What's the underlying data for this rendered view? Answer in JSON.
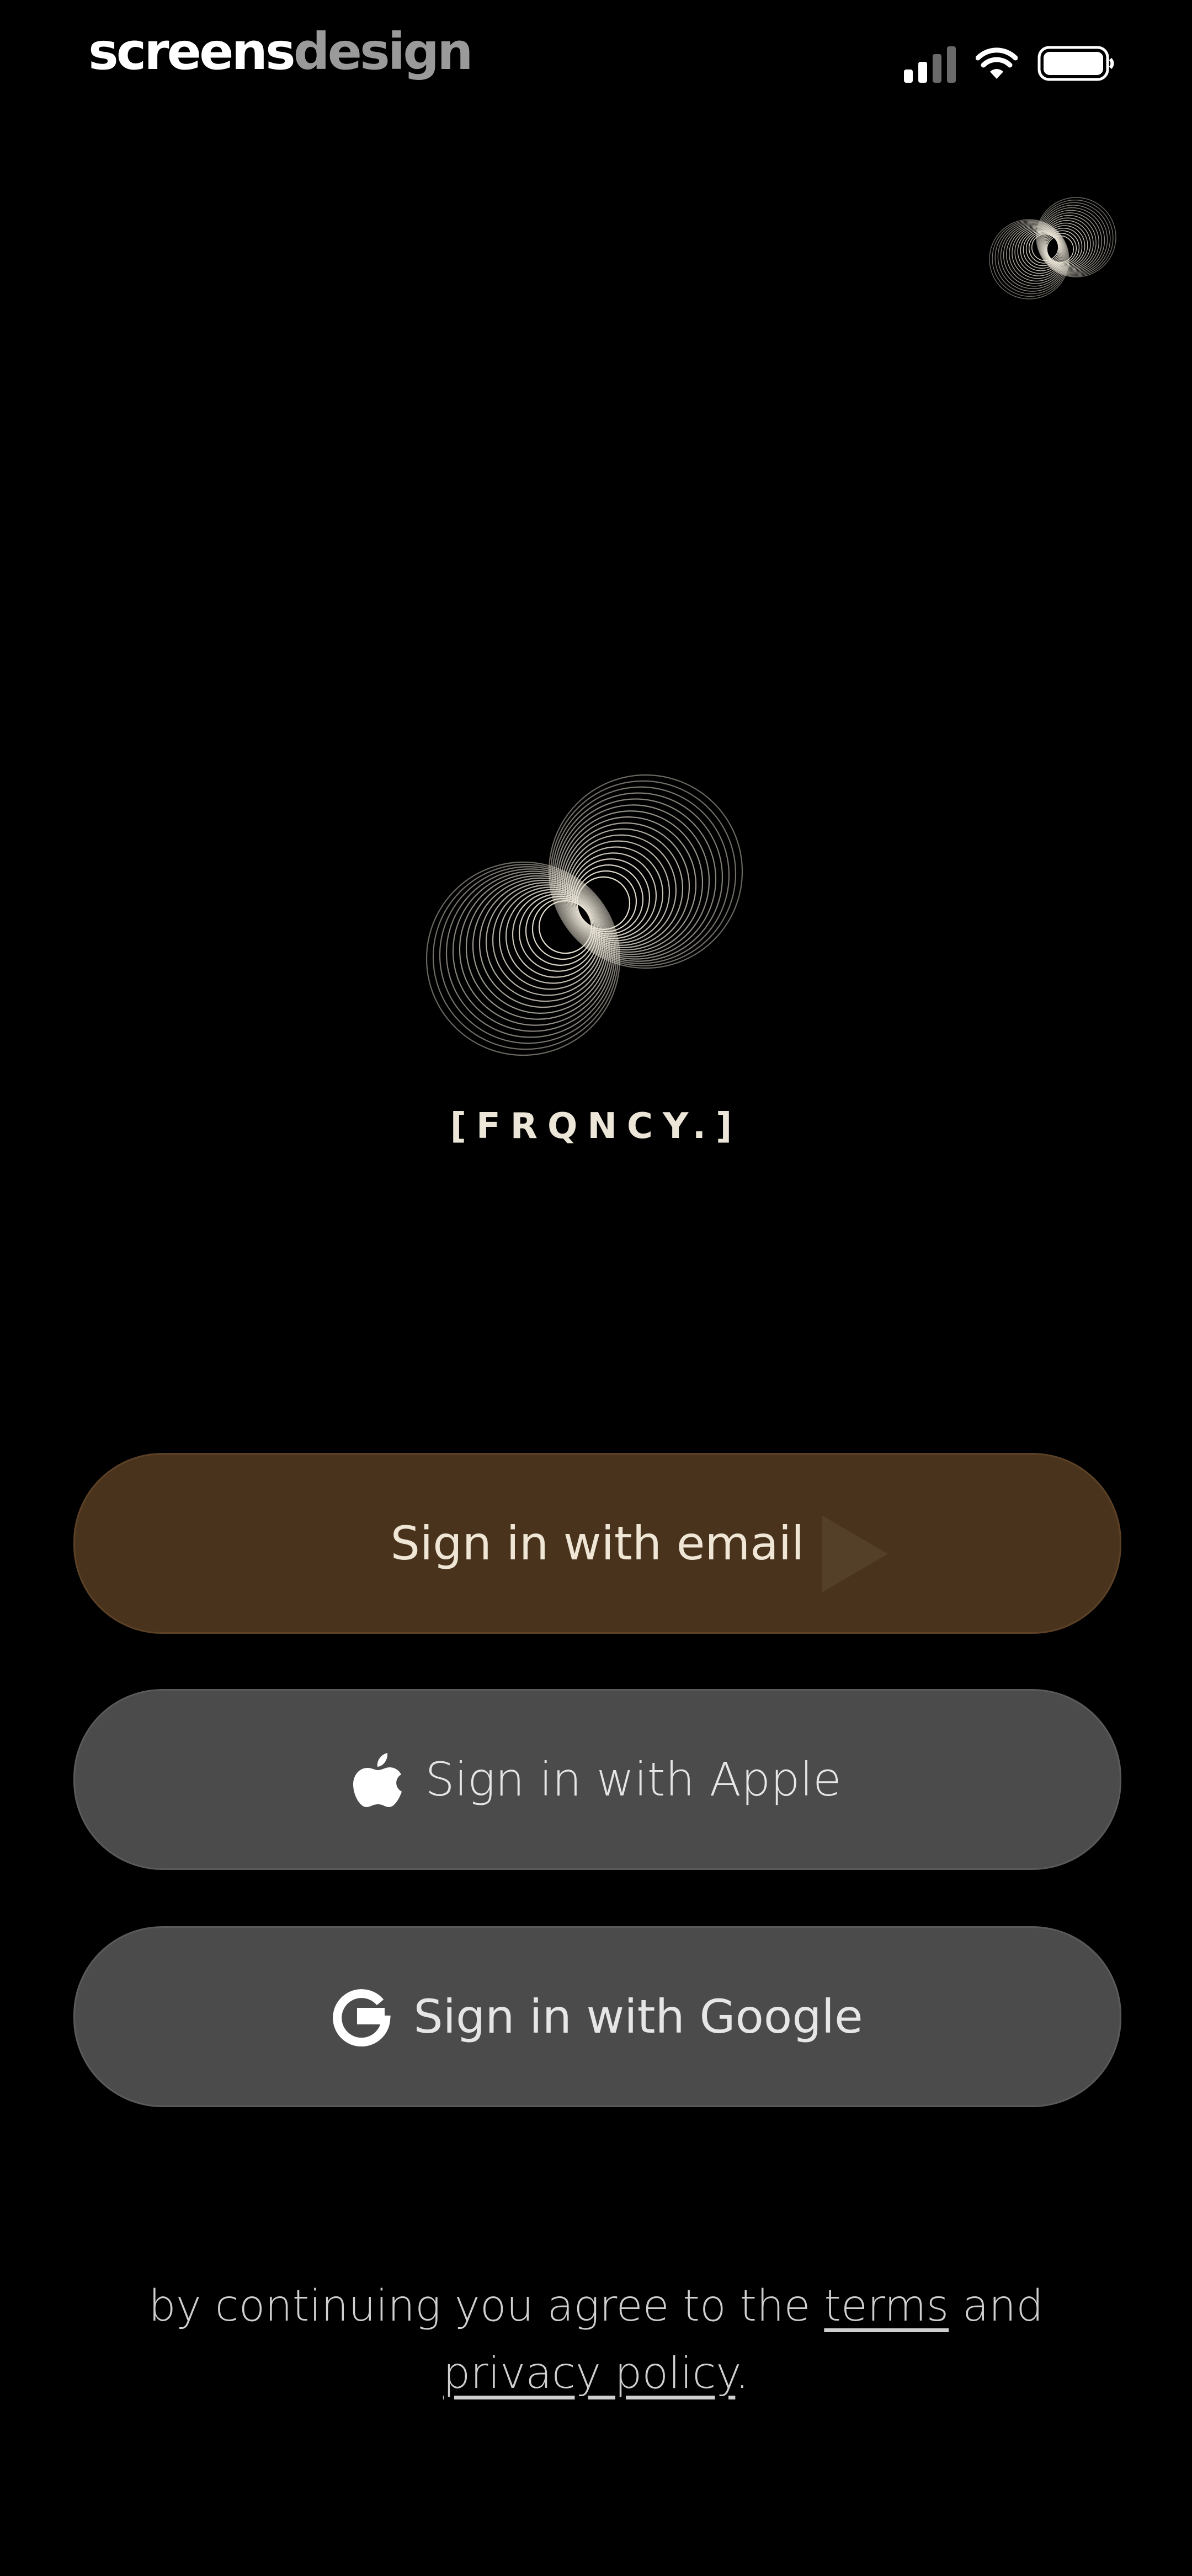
{
  "status_bar": {
    "brand_part1": "screens",
    "brand_part2": "design",
    "icons": [
      "cellular-signal-icon",
      "wifi-icon",
      "battery-icon"
    ]
  },
  "app": {
    "wordmark": "[FRQNCY.]",
    "logo_icon": "interlocking-rings-logo"
  },
  "buttons": {
    "email": {
      "label": "Sign in with email"
    },
    "apple": {
      "label": "Sign in with Apple",
      "icon": "apple-icon"
    },
    "google": {
      "label": "Sign in with Google",
      "icon": "google-icon"
    }
  },
  "footer": {
    "text_before": "by continuing you agree to the ",
    "terms_link": "terms",
    "text_and": " and",
    "privacy_link": "privacy policy",
    "text_end": "."
  },
  "colors": {
    "background": "#000000",
    "email_button": "#4a331c",
    "secondary_button": "#4b4b4b",
    "logo_stroke": "#ece6d8"
  }
}
